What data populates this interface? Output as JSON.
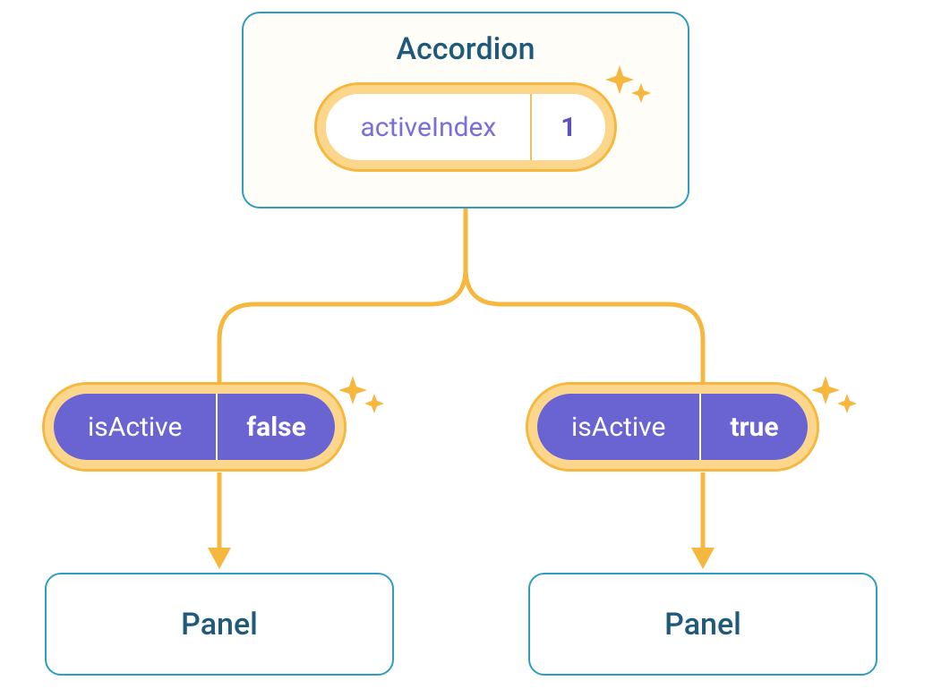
{
  "colors": {
    "boxBorder": "#2e9dc0",
    "boxBg": "#fffdf8",
    "titleText": "#1f5a7a",
    "pillBorderInner": "#fcd68b",
    "pillBorderOuter": "#f6b73e",
    "pillWhiteText": "#6b63cf",
    "pillPurpleBg": "#6a63d2",
    "pillPurpleText": "#ffffff",
    "connector": "#f6b73e",
    "sparkle": "#f6b73e"
  },
  "accordion": {
    "title": "Accordion",
    "state": {
      "name": "activeIndex",
      "value": "1"
    }
  },
  "children": [
    {
      "prop": {
        "name": "isActive",
        "value": "false"
      },
      "label": "Panel"
    },
    {
      "prop": {
        "name": "isActive",
        "value": "true"
      },
      "label": "Panel"
    }
  ]
}
